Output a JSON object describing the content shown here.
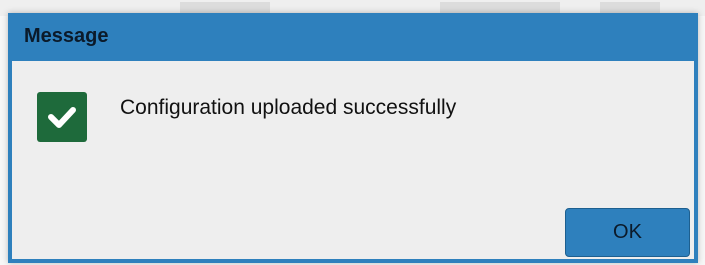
{
  "dialog": {
    "title": "Message",
    "message": "Configuration uploaded successfully",
    "icon": "success-check-icon",
    "ok_label": "OK"
  },
  "colors": {
    "titlebar": "#2e80bd",
    "body": "#eeeeee",
    "success_icon_bg": "#1e6a3b",
    "button": "#2e80bd"
  }
}
